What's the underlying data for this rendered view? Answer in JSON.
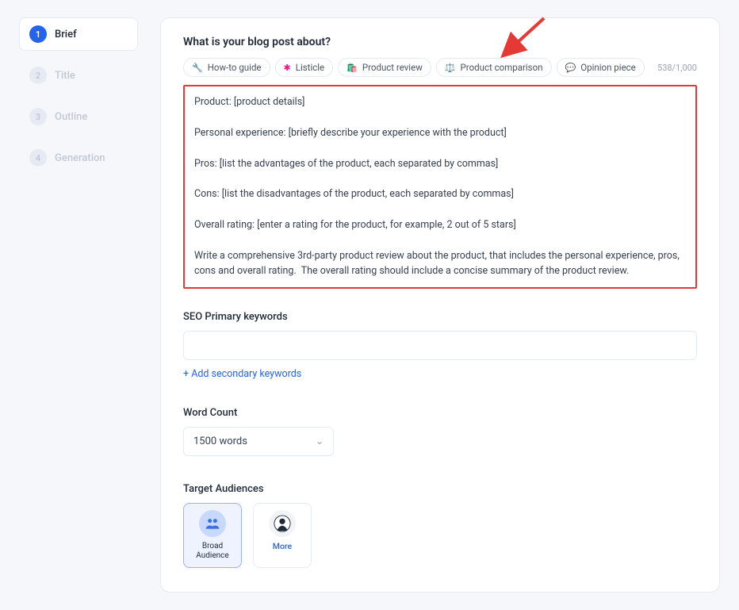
{
  "steps": [
    {
      "num": "1",
      "label": "Brief",
      "active": true
    },
    {
      "num": "2",
      "label": "Title",
      "active": false
    },
    {
      "num": "3",
      "label": "Outline",
      "active": false
    },
    {
      "num": "4",
      "label": "Generation",
      "active": false
    }
  ],
  "briefTitle": "What is your blog post about?",
  "chips": [
    {
      "label": "How-to guide",
      "icon": "🔧",
      "iconName": "wrench-icon"
    },
    {
      "label": "Listicle",
      "icon": "✱",
      "iconName": "asterisk-icon",
      "iconColor": "#e11d8f"
    },
    {
      "label": "Product review",
      "icon": "🛍️",
      "iconName": "bag-icon"
    },
    {
      "label": "Product comparison",
      "icon": "⚖️",
      "iconName": "scale-icon",
      "iconColor": "#f59e0b"
    },
    {
      "label": "Opinion piece",
      "icon": "💬",
      "iconName": "speech-icon",
      "iconColor": "#60a5fa"
    }
  ],
  "charCount": "538/1,000",
  "briefText": "Product: [product details]\n\nPersonal experience: [briefly describe your experience with the product]\n\nPros: [list the advantages of the product, each separated by commas]\n\nCons: [list the disadvantages of the product, each separated by commas]\n\nOverall rating: [enter a rating for the product, for example, 2 out of 5 stars]\n\nWrite a comprehensive 3rd-party product review about the product, that includes the personal experience, pros, cons and overall rating.  The overall rating should include a concise summary of the product review.",
  "seoLabel": "SEO Primary keywords",
  "seoValue": "",
  "addSecondary": "+ Add secondary keywords",
  "wordCountLabel": "Word Count",
  "wordCountValue": "1500 words",
  "targetAudiencesLabel": "Target Audiences",
  "audiences": {
    "broad": "Broad Audience",
    "more": "More"
  },
  "colors": {
    "accent": "#2563eb",
    "highlight": "#e53935"
  }
}
